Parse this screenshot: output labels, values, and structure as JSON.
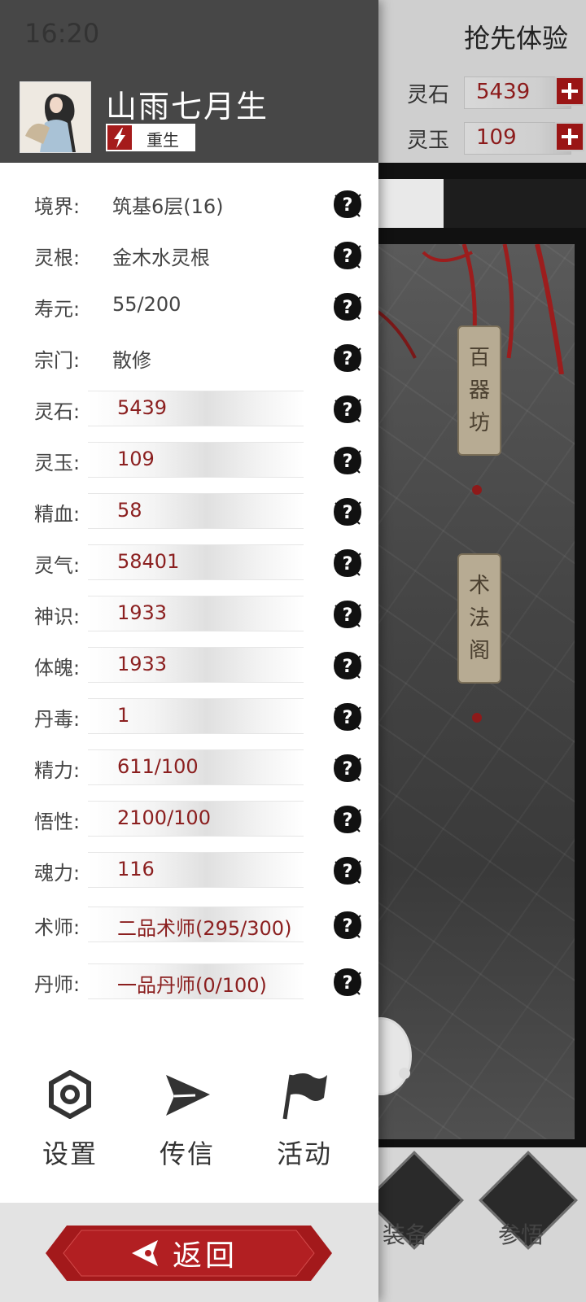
{
  "status_bar": {
    "time": "16:20"
  },
  "background": {
    "title": "抢先体验",
    "resources": [
      {
        "label": "灵石",
        "value": "5439"
      },
      {
        "label": "灵玉",
        "value": "109"
      }
    ],
    "signs": [
      {
        "chars": [
          "百",
          "器",
          "坊"
        ]
      },
      {
        "chars": [
          "术",
          "法",
          "阁"
        ]
      }
    ],
    "bottom_buttons": [
      {
        "label": "装备"
      },
      {
        "label": "参悟"
      }
    ]
  },
  "profile": {
    "name": "山雨七月生",
    "rebirth_label": "重生"
  },
  "stats": [
    {
      "label": "境界:",
      "value": "筑基6层(16)",
      "style": "plain"
    },
    {
      "label": "灵根:",
      "value": "金木水灵根",
      "style": "plain"
    },
    {
      "label": "寿元:",
      "value": "55/200",
      "style": "plain"
    },
    {
      "label": "宗门:",
      "value": "散修",
      "style": "plain"
    },
    {
      "label": "灵石:",
      "value": "5439",
      "style": "bar"
    },
    {
      "label": "灵玉:",
      "value": "109",
      "style": "bar"
    },
    {
      "label": "精血:",
      "value": "58",
      "style": "bar"
    },
    {
      "label": "灵气:",
      "value": "58401",
      "style": "bar"
    },
    {
      "label": "神识:",
      "value": "1933",
      "style": "bar"
    },
    {
      "label": "体魄:",
      "value": "1933",
      "style": "bar"
    },
    {
      "label": "丹毒:",
      "value": "1",
      "style": "bar"
    },
    {
      "label": "精力:",
      "value": "611/100",
      "style": "bar"
    },
    {
      "label": "悟性:",
      "value": "2100/100",
      "style": "bar"
    },
    {
      "label": "魂力:",
      "value": "116",
      "style": "bar"
    },
    {
      "label": "术师:",
      "value": "二品术师(295/300)",
      "style": "bar"
    },
    {
      "label": "丹师:",
      "value": "一品丹师(0/100)",
      "style": "bar"
    }
  ],
  "actions": [
    {
      "label": "设置",
      "icon": "settings-icon"
    },
    {
      "label": "传信",
      "icon": "send-icon"
    },
    {
      "label": "活动",
      "icon": "flag-icon"
    }
  ],
  "footer": {
    "back_label": "返回"
  },
  "colors": {
    "accent_red": "#a51b1b",
    "value_red": "#8b1f1f",
    "header_gray": "#474747"
  }
}
